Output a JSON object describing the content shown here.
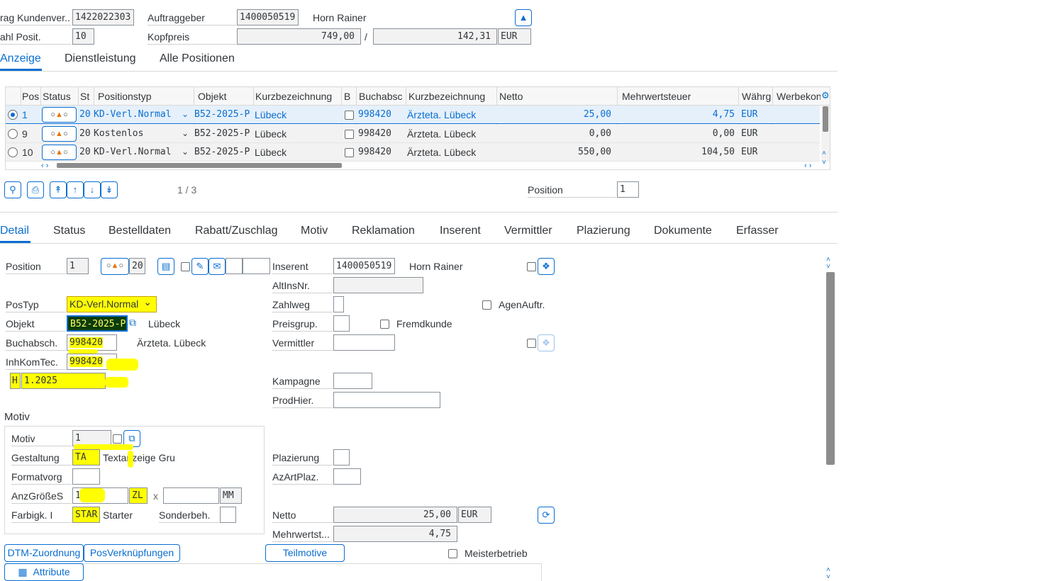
{
  "header": {
    "auftrag_label": "rag Kundenver...",
    "auftrag_value": "1422022303",
    "auftraggeber_label": "Auftraggeber",
    "auftraggeber_value": "1400050519",
    "auftraggeber_name": "Horn Rainer",
    "anzahl_label": "ahl Posit.",
    "anzahl_value": "10",
    "kopfpreis_label": "Kopfpreis",
    "kopfpreis_value": "749,00",
    "kopfpreis_slash": "/",
    "kopfpreis_value2": "142,31",
    "currency": "EUR"
  },
  "top_tabs": [
    "Anzeige",
    "Dienstleistung",
    "Alle Positionen"
  ],
  "table": {
    "columns": [
      "Pos",
      "Status",
      "St",
      "Positionstyp",
      "Objekt",
      "Kurzbezeichnung",
      "B",
      "Buchabsc",
      "Kurzbezeichnung",
      "Netto",
      "Mehrwertsteuer",
      "Währg",
      "Werbekon"
    ],
    "rows": [
      {
        "pos": "1",
        "st": "20",
        "typ": "KD-Verl.Normal",
        "objekt": "B52-2025-P",
        "kurz": "Lübeck",
        "buch": "998420",
        "kurz2": "Ärzteta. Lübeck",
        "netto": "25,00",
        "mwst": "4,75",
        "waehrg": "EUR"
      },
      {
        "pos": "9",
        "st": "20",
        "typ": "Kostenlos",
        "objekt": "B52-2025-P",
        "kurz": "Lübeck",
        "buch": "998420",
        "kurz2": "Ärzteta. Lübeck",
        "netto": "0,00",
        "mwst": "0,00",
        "waehrg": "EUR"
      },
      {
        "pos": "10",
        "st": "20",
        "typ": "KD-Verl.Normal",
        "objekt": "B52-2025-P",
        "kurz": "Lübeck",
        "buch": "998420",
        "kurz2": "Ärzteta. Lübeck",
        "netto": "550,00",
        "mwst": "104,50",
        "waehrg": "EUR"
      }
    ],
    "pager": "1 / 3",
    "position_label": "Position",
    "position_value": "1"
  },
  "detail_tabs": [
    "Detail",
    "Status",
    "Bestelldaten",
    "Rabatt/Zuschlag",
    "Motiv",
    "Reklamation",
    "Inserent",
    "Vermittler",
    "Plazierung",
    "Dokumente",
    "Erfasser"
  ],
  "detail": {
    "position_label": "Position",
    "position_value": "1",
    "status_num": "20",
    "inserent_label": "Inserent",
    "inserent_value": "1400050519",
    "inserent_name": "Horn Rainer",
    "altinsnr_label": "AltInsNr.",
    "postyp_label": "PosTyp",
    "postyp_value": "KD-Verl.Normal",
    "zahlweg_label": "Zahlweg",
    "agenauftr_label": "AgenAuftr.",
    "objekt_label": "Objekt",
    "objekt_value": "B52-2025-P",
    "objekt_text": "Lübeck",
    "preisgrup_label": "Preisgrup.",
    "fremdkunde_label": "Fremdkunde",
    "buchabsch_label": "Buchabsch.",
    "buchabsch_value": "998420",
    "buchabsch_text": "Ärzteta. Lübeck",
    "vermittler_label": "Vermittler",
    "inhkomtec_label": "InhKomTec.",
    "inhkomtec_value": "998420",
    "h_value": "H",
    "date_value": "1.2025",
    "kampagne_label": "Kampagne",
    "prodhier_label": "ProdHier."
  },
  "motiv": {
    "section_title": "Motiv",
    "motiv_label": "Motiv",
    "motiv_value": "1",
    "gestaltung_label": "Gestaltung",
    "gestaltung_value": "TA",
    "gestaltung_text": "Textanzeige Gru",
    "formatvorg_label": "Formatvorg",
    "anzgroesse_label": "AnzGrößeS",
    "anzgroesse_value": "1",
    "anzgroesse_unit": "ZL",
    "times": "x",
    "mm_unit": "MM",
    "farbigk_label": "Farbigk. I",
    "farbigk_value": "STAR",
    "farbigk_text": "Starter",
    "sonderbeh_label": "Sonderbeh."
  },
  "right_lower": {
    "plazierung_label": "Plazierung",
    "azartplaz_label": "AzArtPlaz.",
    "netto_label": "Netto",
    "netto_value": "25,00",
    "netto_currency": "EUR",
    "mwst_label": "Mehrwertst...",
    "mwst_value": "4,75",
    "meisterbetrieb_label": "Meisterbetrieb"
  },
  "buttons": {
    "dtm": "DTM-Zuordnung",
    "posverk": "PosVerknüpfungen",
    "teilmotive": "Teilmotive",
    "attribute": "Attribute"
  },
  "colors": {
    "accent": "#0a6ed1",
    "highlight": "#ffff00",
    "selected_row": "#e5f0fa"
  }
}
